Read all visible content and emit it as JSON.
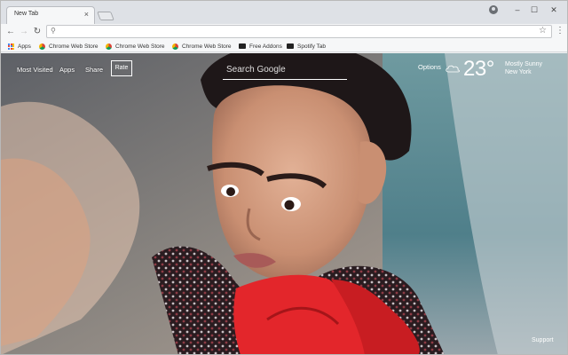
{
  "browser": {
    "tab": {
      "title": "New Tab",
      "close": "×"
    },
    "controls": {
      "minimize": "–",
      "maximize": "☐",
      "close": "✕"
    },
    "omnibox": {
      "value": "",
      "placeholder": ""
    },
    "bookmarks": [
      {
        "label": "Apps",
        "icon": "apps-grid-icon"
      },
      {
        "label": "Chrome Web Store",
        "icon": "chrome-web-store-icon"
      },
      {
        "label": "Chrome Web Store",
        "icon": "chrome-web-store-icon"
      },
      {
        "label": "Chrome Web Store",
        "icon": "chrome-web-store-icon"
      },
      {
        "label": "Free Addons",
        "icon": "free-addons-icon"
      },
      {
        "label": "Spotify Tab",
        "icon": "spotify-tab-icon"
      }
    ]
  },
  "page": {
    "nav": {
      "most_visited": "Most Visited",
      "apps": "Apps",
      "share": "Share",
      "rate": "Rate"
    },
    "search": {
      "placeholder": "Search Google"
    },
    "options": "Options",
    "weather": {
      "temperature": "23°",
      "condition": "Mostly Sunny",
      "location": "New York"
    },
    "support": "Support"
  },
  "colors": {
    "tab_strip": "#dee1e6",
    "toolbar": "#f6f7f8",
    "scarf_red": "#e3262b",
    "text_white": "#ffffff"
  }
}
